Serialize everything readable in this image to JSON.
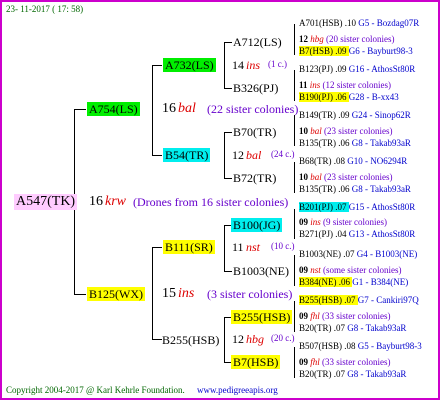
{
  "header": {
    "date": "23- 11-2017 ( 17: 58)"
  },
  "footer": {
    "copyright": "Copyright 2004-2017 @ Karl Kehrle Foundation.",
    "url": "www.pedigreeapis.org"
  },
  "colors": {
    "frame": "#cc00cc",
    "green": "#00ee00",
    "cyan": "#00eeee",
    "yellow": "#ffff00",
    "pink": "#ffccff",
    "red": "#dd0000",
    "blue": "#0000cc"
  },
  "root": {
    "label": "A547(TK)",
    "year": "16",
    "code": "krw",
    "note": "(Drones from 16 sister colonies)"
  },
  "gen1": [
    {
      "label": "A754(LS)",
      "year": "16",
      "code": "bal",
      "note": "(22 sister colonies)"
    },
    {
      "label": "B125(WX)",
      "year": "15",
      "code": "ins",
      "note": "(3 sister colonies)"
    }
  ],
  "gen2": [
    {
      "label": "A732(LS)",
      "year": "14",
      "code": "ins",
      "note": "(1 c.)"
    },
    {
      "label": "B54(TR)",
      "year": "12",
      "code": "bal",
      "note": "(24 c.)"
    },
    {
      "label": "B111(SR)",
      "year": "11",
      "code": "nst",
      "note": "(10 c.)"
    },
    {
      "label": "B255(HSB)",
      "year": "12",
      "code": "hbg",
      "note": "(20 c.)"
    }
  ],
  "gen3": [
    "A712(LS)",
    "B326(PJ)",
    "B70(TR)",
    "B72(TR)",
    "B100(JG)",
    "B1003(NE)",
    "B255(HSB)",
    "B7(HSB)"
  ],
  "gen4": [
    {
      "name": "A701(HSB)",
      "year": ".10",
      "info": "G5 - Bozdag07R"
    },
    {
      "name": "12",
      "year": "hbg",
      "info": "(20 sister colonies)"
    },
    {
      "name": "B7(HSB)",
      "year": ".09",
      "info": "G6 - Bayburt98-3"
    },
    {
      "name": "B123(PJ)",
      "year": ".09",
      "info": "G16 - AthosSt80R"
    },
    {
      "name": "11",
      "year": "ins",
      "info": "(12 sister colonies)"
    },
    {
      "name": "B190(PJ)",
      "year": ".06",
      "info": "G28 - B-xx43"
    },
    {
      "name": "B149(TR)",
      "year": ".09",
      "info": "G24 - Sinop62R"
    },
    {
      "name": "10",
      "year": "bal",
      "info": "(23 sister colonies)"
    },
    {
      "name": "B135(TR)",
      "year": ".06",
      "info": "G8 - Takab93aR"
    },
    {
      "name": "B68(TR)",
      "year": ".08",
      "info": "G10 - NO6294R"
    },
    {
      "name": "10",
      "year": "bal",
      "info": "(23 sister colonies)"
    },
    {
      "name": "B135(TR)",
      "year": ".06",
      "info": "G8 - Takab93aR"
    },
    {
      "name": "B201(PJ)",
      "year": ".07",
      "info": "G15 - AthosSt80R"
    },
    {
      "name": "09",
      "year": "ins",
      "info": "(9 sister colonies)"
    },
    {
      "name": "B271(PJ)",
      "year": ".04",
      "info": "G13 - AthosSt80R"
    },
    {
      "name": "B1003(NE)",
      "year": ".07",
      "info": "G4 - B1003(NE)"
    },
    {
      "name": "09",
      "year": "nst",
      "info": "(some sister colonies)"
    },
    {
      "name": "B384(NE)",
      "year": ".06",
      "info": "G1 - B384(NE)"
    },
    {
      "name": "B255(HSB)",
      "year": ".07",
      "info": "G7 - Cankiri97Q"
    },
    {
      "name": "09",
      "year": "fhl",
      "info": "(33 sister colonies)"
    },
    {
      "name": "B20(TR)",
      "year": ".07",
      "info": "G8 - Takab93aR"
    },
    {
      "name": "B507(HSB)",
      "year": ".08",
      "info": "G5 - Bayburt98-3"
    },
    {
      "name": "09",
      "year": "fhl",
      "info": "(33 sister colonies)"
    },
    {
      "name": "B20(TR)",
      "year": ".07",
      "info": "G8 - Takab93aR"
    }
  ]
}
